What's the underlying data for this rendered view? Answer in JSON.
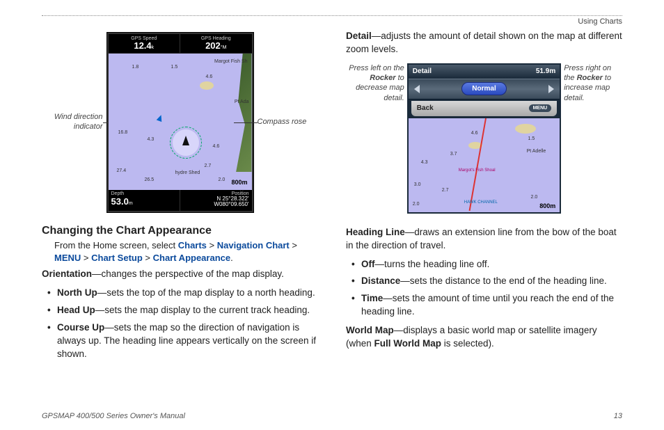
{
  "header": {
    "breadcrumb": "Using Charts"
  },
  "fig1": {
    "left_callout": "Wind direction indicator",
    "right_callout": "Compass rose",
    "gps_speed_label": "GPS Speed",
    "gps_speed_value": "12.4",
    "gps_speed_unit": "k",
    "gps_heading_label": "GPS Heading",
    "gps_heading_value": "202",
    "gps_heading_unit": "°M",
    "depth_label_top_right": "Margot Fish Sh",
    "depth_label_pt": "Pt Ada",
    "scale": "800m",
    "bottom_depth_label": "Depth",
    "bottom_depth_value": "53.0",
    "bottom_depth_unit": "m",
    "bottom_pos_label": "Position",
    "bottom_pos_lat": "N  25°28.322'",
    "bottom_pos_lon": "W080°09.650'",
    "depths": {
      "d1": "1.8",
      "d2": "1.5",
      "d3": "4.6",
      "d4": "16.8",
      "d5": "4.3",
      "d6": "4.6",
      "d7": "27.4",
      "d8": "26.5",
      "d9": "2.7",
      "d10": "2.0"
    },
    "hydro_label": "hydre Shed"
  },
  "left": {
    "section_title": "Changing the Chart Appearance",
    "path_prefix": "From the Home screen, select ",
    "path_charts": "Charts",
    "path_nav": "Navigation Chart",
    "path_menu": "MENU",
    "path_setup": "Chart Setup",
    "path_appear": "Chart Appearance",
    "orientation_term": "Orientation",
    "orientation_desc": "—changes the perspective of the map display.",
    "items": [
      {
        "term": "North Up",
        "desc": "—sets the top of the map display to a north heading."
      },
      {
        "term": "Head Up",
        "desc": "—sets the map display to the current track heading."
      },
      {
        "term": "Course Up",
        "desc": "—sets the map so the direction of navigation is always up. The heading line appears vertically on the screen if shown."
      }
    ]
  },
  "right": {
    "detail_term": "Detail",
    "detail_desc": "—adjusts the amount of detail shown on the map at different zoom levels.",
    "fig2": {
      "left_callout_pre": "Press left on the ",
      "left_callout_bold": "Rocker",
      "left_callout_post": " to decrease map detail.",
      "right_callout_pre": "Press right on the ",
      "right_callout_bold": "Rocker",
      "right_callout_post": " to increase map detail.",
      "title": "Detail",
      "range": "51.9m",
      "slider_value": "Normal",
      "back": "Back",
      "menu": "MENU",
      "pt_label": "Pt Adelle",
      "shoal": "Margot's Fish Shoal",
      "channel": "HAWK CHANNEL",
      "scale": "800m",
      "depths": {
        "d1": "4.6",
        "d2": "1.5",
        "d3": "3.7",
        "d4": "4.3",
        "d5": "3.0",
        "d6": "2.7",
        "d7": "2.0",
        "d8": "2.0"
      }
    },
    "heading_term": "Heading Line",
    "heading_desc": "—draws an extension line from the bow of the boat in the direction of travel.",
    "items": [
      {
        "term": "Off",
        "desc": "—turns the heading line off."
      },
      {
        "term": "Distance",
        "desc": "—sets the distance to the end of the heading line."
      },
      {
        "term": "Time",
        "desc": "—sets the amount of time until you reach the end of the heading line."
      }
    ],
    "world_term": "World Map",
    "world_desc_pre": "—displays a basic world map or satellite imagery (when ",
    "world_bold": "Full World Map",
    "world_desc_post": " is selected)."
  },
  "footer": {
    "manual": "GPSMAP 400/500 Series Owner's Manual",
    "page": "13"
  }
}
